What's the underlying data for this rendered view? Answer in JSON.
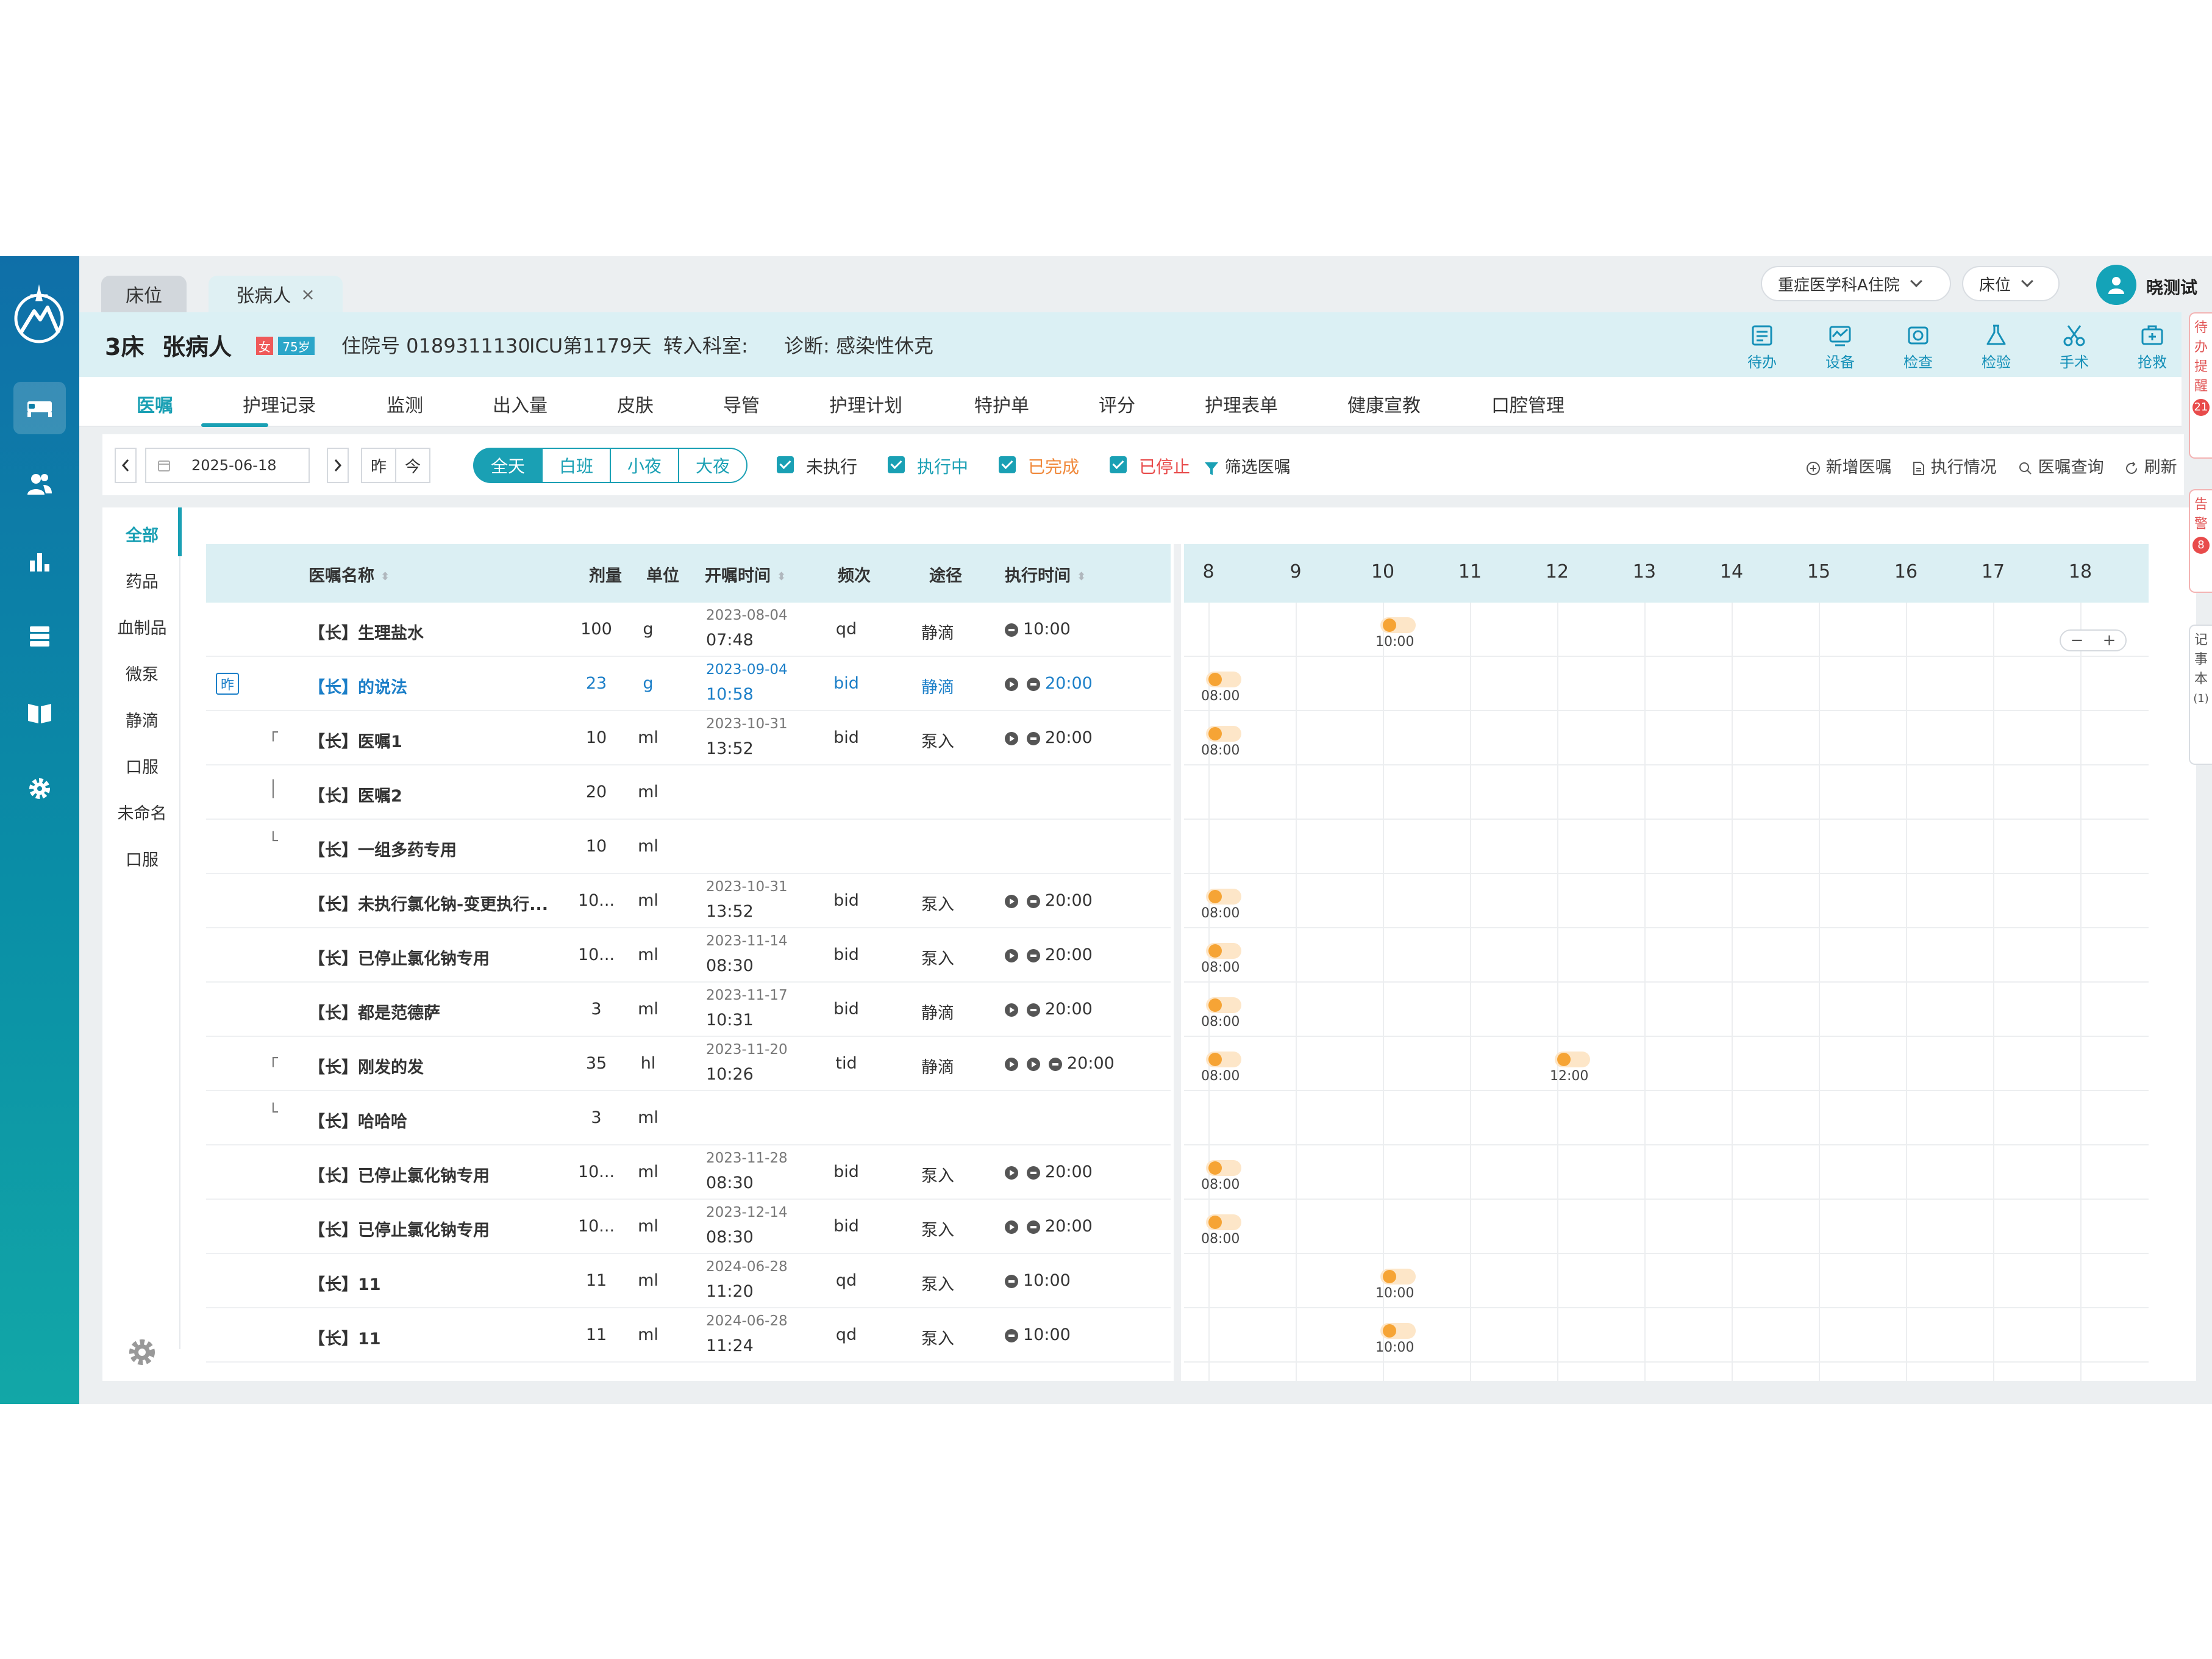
{
  "tabs": [
    {
      "label": "床位"
    },
    {
      "label": "张病人",
      "close": "×"
    }
  ],
  "topbar": {
    "dept": "重症医学科A住院",
    "bed_select": "床位",
    "user_name": "晓测试"
  },
  "patient": {
    "bed": "3床",
    "name": "张病人",
    "sex": "女",
    "age": "75岁",
    "admission_no": "住院号 0189311130",
    "icu_days": "ICU第1179天",
    "transfer": "转入科室:",
    "diagnosis": "诊断: 感染性休克"
  },
  "tools": [
    "待办",
    "设备",
    "检查",
    "检验",
    "手术",
    "抢救"
  ],
  "module_tabs": [
    "医嘱",
    "护理记录",
    "监测",
    "出入量",
    "皮肤",
    "导管",
    "护理计划",
    "特护单",
    "评分",
    "护理表单",
    "健康宣教",
    "口腔管理"
  ],
  "toolbar": {
    "date": "2025-06-18",
    "yesterday": "昨",
    "today": "今",
    "shifts": [
      "全天",
      "白班",
      "小夜",
      "大夜"
    ],
    "filters": [
      {
        "label": "未执行",
        "color": "#333333"
      },
      {
        "label": "执行中",
        "color": "#1aa0b4"
      },
      {
        "label": "已完成",
        "color": "#f0883a"
      },
      {
        "label": "已停止",
        "color": "#e84b4b"
      }
    ],
    "filter_orders": "筛选医嘱",
    "actions": [
      "新增医嘱",
      "执行情况",
      "医嘱查询",
      "刷新"
    ]
  },
  "categories": [
    "全部",
    "药品",
    "血制品",
    "微泵",
    "静滴",
    "口服",
    "未命名",
    "口服"
  ],
  "table": {
    "headers": {
      "name": "医嘱名称",
      "dose": "剂量",
      "unit": "单位",
      "start": "开嘱时间",
      "freq": "频次",
      "route": "途径",
      "exec": "执行时间"
    },
    "rows": [
      {
        "name": "【长】生理盐水",
        "dose": "100",
        "unit": "g",
        "d1": "2023-08-04",
        "d2": "07:48",
        "freq": "qd",
        "route": "静滴",
        "exec": "10:00"
      },
      {
        "name": "【长】的说法",
        "dose": "23",
        "unit": "g",
        "d1": "2023-09-04",
        "d2": "10:58",
        "freq": "bid",
        "route": "静滴",
        "exec": "20:00",
        "tag": "昨"
      },
      {
        "name": "【长】医嘱1",
        "dose": "10",
        "unit": "ml",
        "d1": "2023-10-31",
        "d2": "13:52",
        "freq": "bid",
        "route": "泵入",
        "exec": "20:00",
        "grp": "┌"
      },
      {
        "name": "【长】医嘱2",
        "dose": "20",
        "unit": "ml",
        "d1": "",
        "d2": "",
        "freq": "",
        "route": "",
        "exec": "",
        "grp": "│"
      },
      {
        "name": "【长】一组多药专用",
        "dose": "10",
        "unit": "ml",
        "d1": "",
        "d2": "",
        "freq": "",
        "route": "",
        "exec": "",
        "grp": "└"
      },
      {
        "name": "【长】未执行氯化钠-变更执行...",
        "dose": "10...",
        "unit": "ml",
        "d1": "2023-10-31",
        "d2": "13:52",
        "freq": "bid",
        "route": "泵入",
        "exec": "20:00"
      },
      {
        "name": "【长】已停止氯化钠专用",
        "dose": "10...",
        "unit": "ml",
        "d1": "2023-11-14",
        "d2": "08:30",
        "freq": "bid",
        "route": "泵入",
        "exec": "20:00"
      },
      {
        "name": "【长】都是范德萨",
        "dose": "3",
        "unit": "ml",
        "d1": "2023-11-17",
        "d2": "10:31",
        "freq": "bid",
        "route": "静滴",
        "exec": "20:00"
      },
      {
        "name": "【长】刚发的发",
        "dose": "35",
        "unit": "hl",
        "d1": "2023-11-20",
        "d2": "10:26",
        "freq": "tid",
        "route": "静滴",
        "exec": "20:00",
        "grp": "┌",
        "extra_icon": true
      },
      {
        "name": "【长】哈哈哈",
        "dose": "3",
        "unit": "ml",
        "d1": "",
        "d2": "",
        "freq": "",
        "route": "",
        "exec": "",
        "grp": "└"
      },
      {
        "name": "【长】已停止氯化钠专用",
        "dose": "10...",
        "unit": "ml",
        "d1": "2023-11-28",
        "d2": "08:30",
        "freq": "bid",
        "route": "泵入",
        "exec": "20:00"
      },
      {
        "name": "【长】已停止氯化钠专用",
        "dose": "10...",
        "unit": "ml",
        "d1": "2023-12-14",
        "d2": "08:30",
        "freq": "bid",
        "route": "泵入",
        "exec": "20:00"
      },
      {
        "name": "【长】11",
        "dose": "11",
        "unit": "ml",
        "d1": "2024-06-28",
        "d2": "11:20",
        "freq": "qd",
        "route": "泵入",
        "exec": "10:00"
      },
      {
        "name": "【长】11",
        "dose": "11",
        "unit": "ml",
        "d1": "2024-06-28",
        "d2": "11:24",
        "freq": "qd",
        "route": "泵入",
        "exec": "10:00"
      }
    ]
  },
  "timeline": {
    "hours": [
      "8",
      "9",
      "10",
      "11",
      "12",
      "13",
      "14",
      "15",
      "16",
      "17",
      "18"
    ],
    "zoom_minus": "−",
    "zoom_plus": "+",
    "markers": [
      {
        "row": 0,
        "time": "10:00"
      },
      {
        "row": 1,
        "time": "08:00"
      },
      {
        "row": 2,
        "time": "08:00"
      },
      {
        "row": 5,
        "time": "08:00"
      },
      {
        "row": 6,
        "time": "08:00"
      },
      {
        "row": 7,
        "time": "08:00"
      },
      {
        "row": 8,
        "time": "08:00"
      },
      {
        "row": 8,
        "time": "12:00"
      },
      {
        "row": 10,
        "time": "08:00"
      },
      {
        "row": 11,
        "time": "08:00"
      },
      {
        "row": 12,
        "time": "10:00"
      },
      {
        "row": 13,
        "time": "10:00"
      }
    ]
  },
  "side_rail": [
    {
      "label": "待办提醒",
      "count": "21"
    },
    {
      "label": "告警",
      "count": "8"
    },
    {
      "label": "记事本",
      "count": "(1)"
    }
  ]
}
